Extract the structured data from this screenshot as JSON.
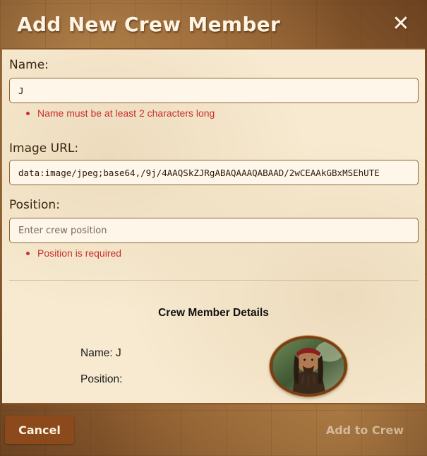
{
  "modal": {
    "title": "Add New Crew Member",
    "close_glyph": "✕"
  },
  "form": {
    "name": {
      "label": "Name:",
      "value": "J",
      "error": "Name must be at least 2 characters long"
    },
    "image_url": {
      "label": "Image URL:",
      "value": "data:image/jpeg;base64,/9j/4AAQSkZJRgABAQAAAQABAAD/2wCEAAkGBxMSEhUTE"
    },
    "position": {
      "label": "Position:",
      "placeholder": "Enter crew position",
      "error": "Position is required"
    }
  },
  "details": {
    "title": "Crew Member Details",
    "name_line": "Name: J",
    "position_line": "Position:",
    "avatar_icon": "crew-portrait"
  },
  "footer": {
    "cancel_label": "Cancel",
    "add_label": "Add to Crew"
  },
  "colors": {
    "accent": "#8c4a1c",
    "error": "#c8302f",
    "panel": "#f7ead0"
  }
}
